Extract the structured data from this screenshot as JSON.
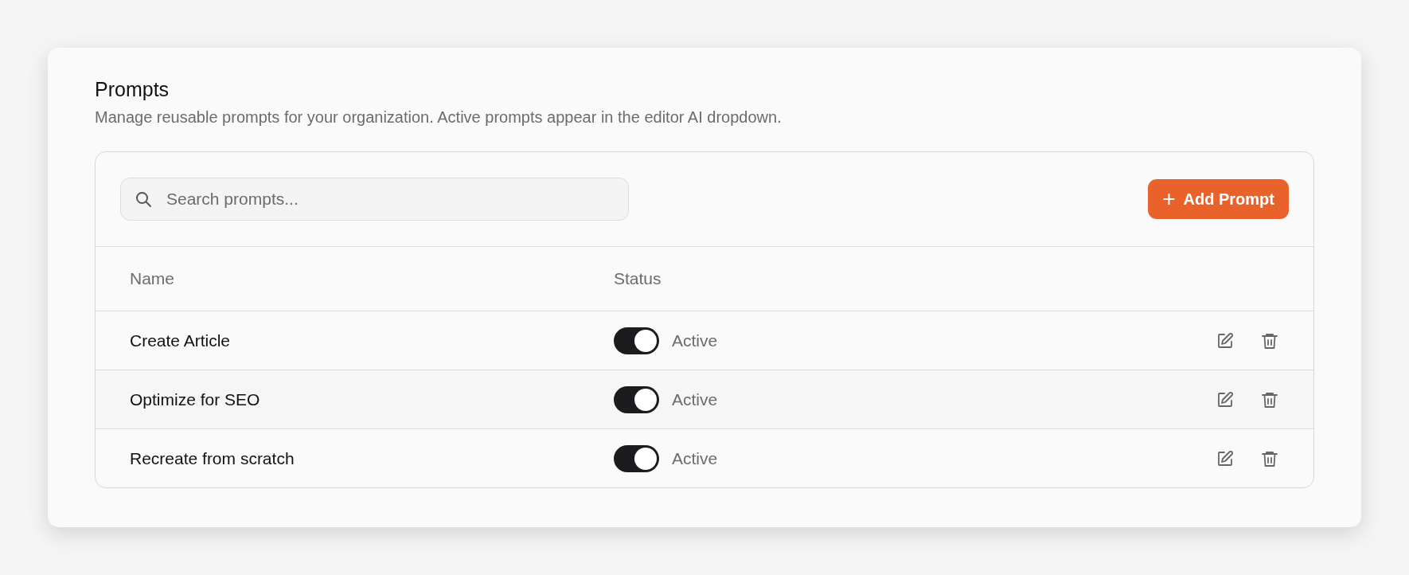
{
  "title": "Prompts",
  "description": "Manage reusable prompts for your organization. Active prompts appear in the editor AI dropdown.",
  "search": {
    "placeholder": "Search prompts..."
  },
  "add_button": {
    "icon": "+",
    "label": "Add Prompt"
  },
  "table": {
    "columns": [
      "Name",
      "Status"
    ],
    "rows": [
      {
        "name": "Create Article",
        "on": true,
        "status": "Active"
      },
      {
        "name": "Optimize for SEO",
        "on": true,
        "status": "Active"
      },
      {
        "name": "Recreate from scratch",
        "on": true,
        "status": "Active"
      }
    ]
  }
}
